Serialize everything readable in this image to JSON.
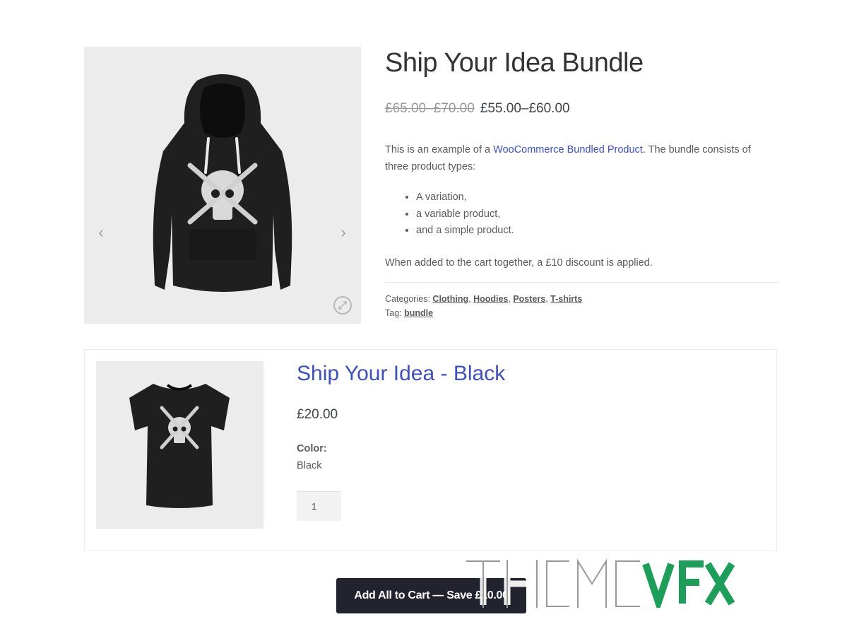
{
  "product": {
    "title": "Ship Your Idea Bundle",
    "price_old": "£65.00–£70.00",
    "price_new": "£55.00–£60.00",
    "desc_before": "This is an example of a ",
    "desc_link": "WooCommerce Bundled Product",
    "desc_after": ". The bundle consists of three product types:",
    "features": [
      "A variation,",
      "a variable product,",
      "and a simple product."
    ],
    "discount_note": "When added to the cart together, a £10 discount is applied.",
    "categories_label": "Categories:",
    "categories": [
      "Clothing",
      "Hoodies",
      "Posters",
      "T-shirts"
    ],
    "tag_label": "Tag:",
    "tag": "bundle"
  },
  "gallery": {
    "prev_icon": "chevron-left-icon",
    "next_icon": "chevron-right-icon",
    "zoom_icon": "zoom-icon"
  },
  "bundled_item": {
    "title": "Ship Your Idea - Black",
    "price": "£20.00",
    "attribute_label": "Color:",
    "attribute_value": "Black",
    "quantity": "1"
  },
  "cart": {
    "button_label": "Add All to Cart — Save £10.00"
  },
  "watermark": {
    "text_light": "THEME",
    "text_accent": "VFX",
    "accent_color": "#1e9e5a"
  },
  "colors": {
    "link": "#3f51b5",
    "button_bg": "#232330",
    "gallery_bg": "#ececec"
  }
}
